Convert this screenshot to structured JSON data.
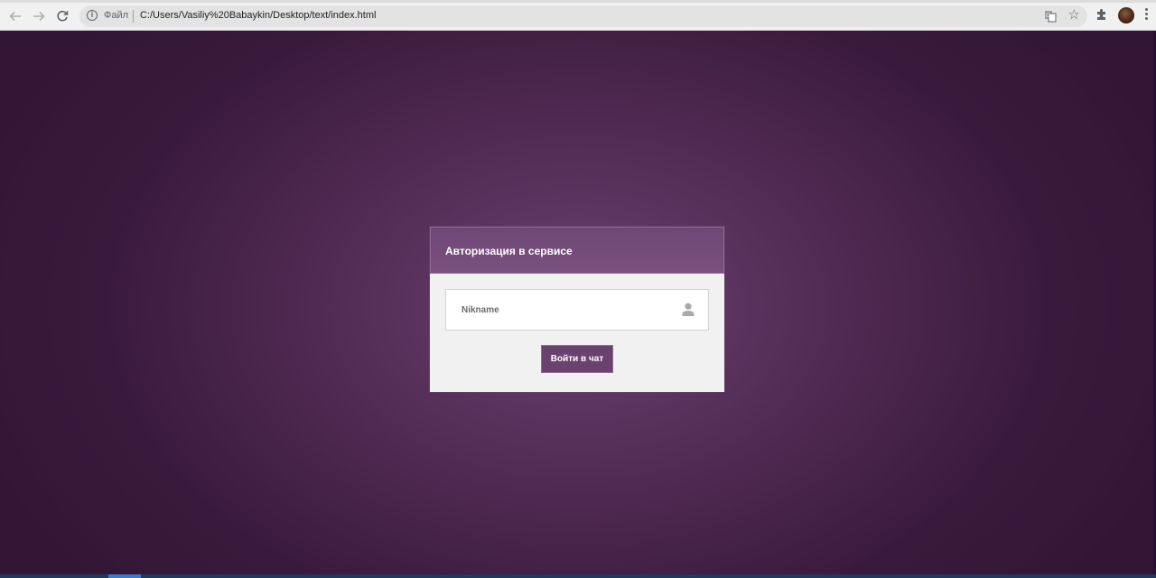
{
  "browser": {
    "scheme_label": "Файл",
    "url": "C:/Users/Vasiliy%20Babaykin/Desktop/text/index.html",
    "icons": [
      "back-arrow-icon",
      "forward-arrow-icon",
      "reload-icon",
      "info-icon",
      "translate-icon",
      "star-icon",
      "extensions-icon",
      "avatar",
      "menu-icon"
    ]
  },
  "auth": {
    "title": "Авторизация в сервисе",
    "nickname_placeholder": "Nikname",
    "nickname_value": "",
    "submit_label": "Войти в чат",
    "icon": "user-icon"
  },
  "colors": {
    "page_background": "#4e2850",
    "header_background": "#7a507e",
    "button_background": "#6a416f",
    "card_background": "#f1f1f1"
  }
}
